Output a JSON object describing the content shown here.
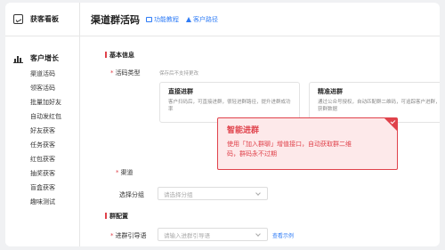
{
  "sidebar": {
    "top_label": "获客看板",
    "group_label": "客户增长",
    "items": [
      "渠道活码",
      "领客活码",
      "批量加好友",
      "自动发红包",
      "好友获客",
      "任务获客",
      "红包获客",
      "抽奖获客",
      "盲盒获客",
      "趣味测试"
    ]
  },
  "header": {
    "title": "渠道群活码",
    "link_tutorial": "功能教程",
    "link_path": "客户路径"
  },
  "form": {
    "section_basic": "基本信息",
    "type_label": "活码类型",
    "type_hint": "保存后不支持更改",
    "card1": {
      "title": "直接进群",
      "desc": "客户扫码后，可直接进群，很轻进群路径，提升进群成功率"
    },
    "card2": {
      "title": "精准进群",
      "desc": "通过公众号授权，自动匹配群二维码，可追踪客户进群，获群数据"
    },
    "channel_label": "渠道",
    "group_label": "选择分组",
    "group_placeholder": "请选择分组",
    "section_group": "群配置",
    "guide_label": "进群引导语",
    "guide_placeholder": "请输入进群引导语",
    "example_link": "查看示例"
  },
  "tooltip": {
    "title": "智能进群",
    "desc_line1": "使用「加入群聊」增值接口，自动获取群二维",
    "desc_line2": "码，群码永不过期"
  },
  "colors": {
    "accent": "#2f7cf6",
    "danger": "#e0424b"
  }
}
